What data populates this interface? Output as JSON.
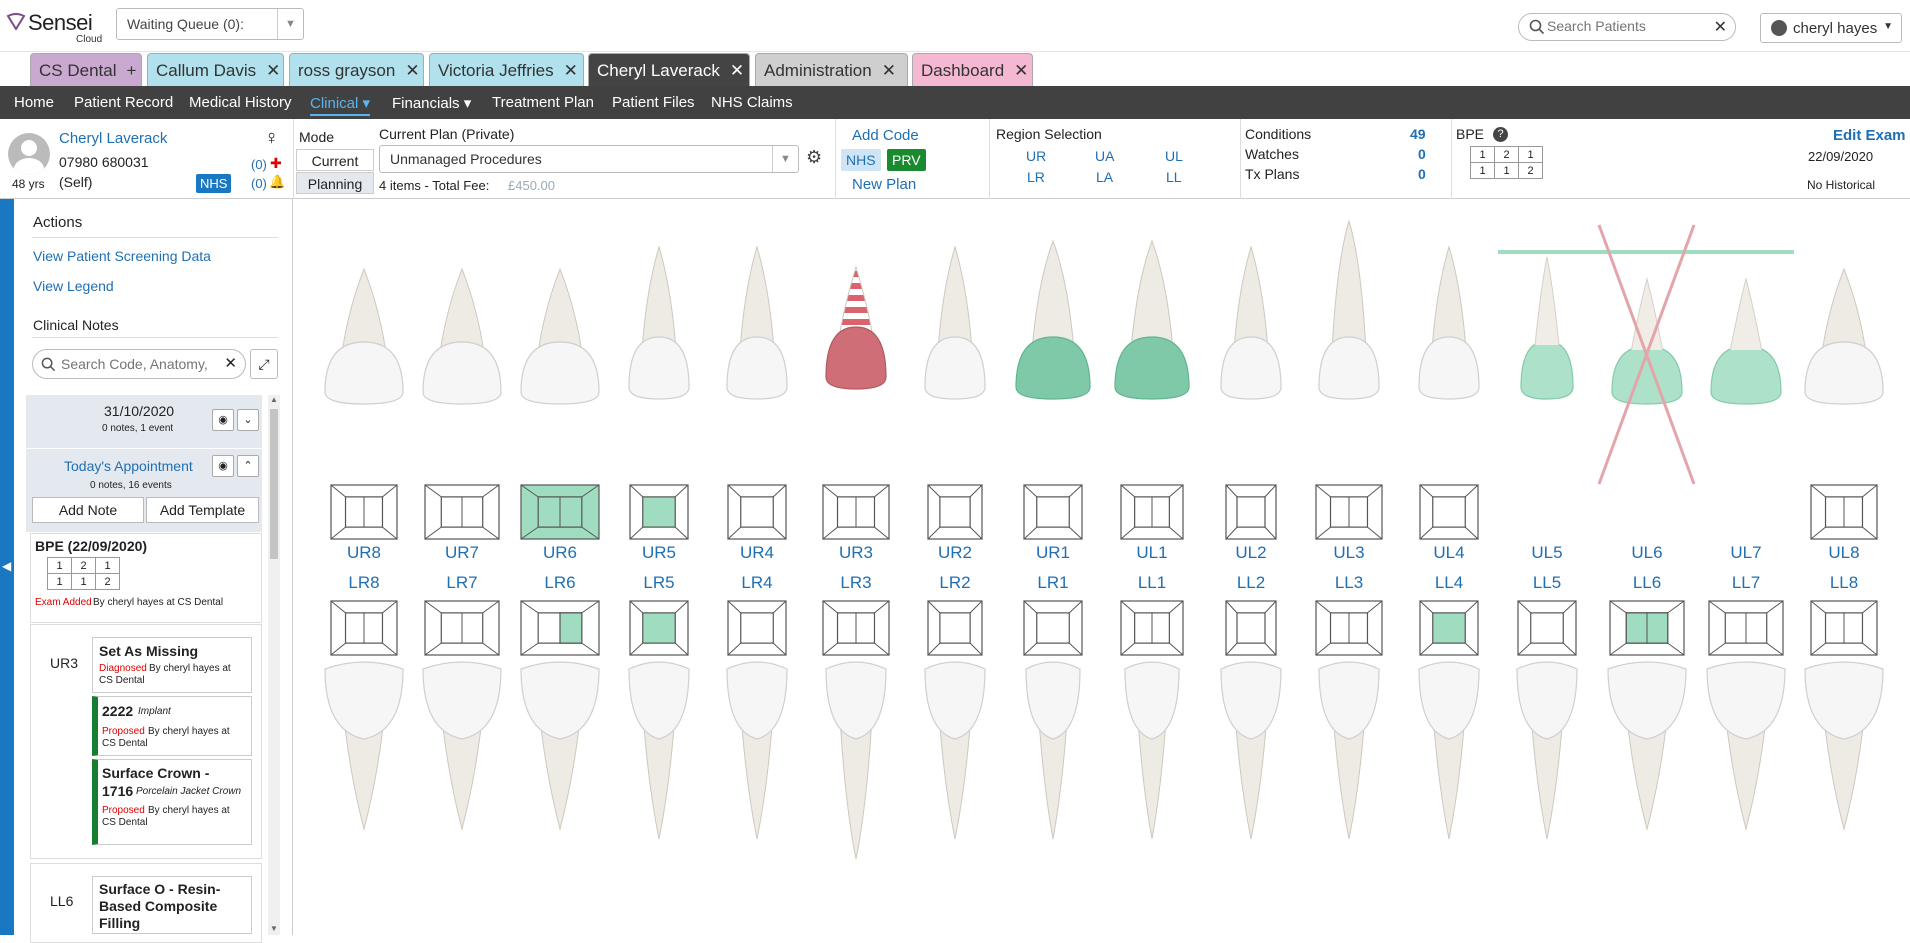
{
  "app": {
    "name": "Sensei",
    "sub": "Cloud"
  },
  "waiting_queue": "Waiting Queue (0):",
  "search": {
    "placeholder": "Search Patients"
  },
  "user": "cheryl hayes",
  "tabs": [
    {
      "label": "CS Dental",
      "icon": "+",
      "bg": "#c9a9cf"
    },
    {
      "label": "Callum Davis",
      "icon": "✕",
      "bg": "#b2e1ee"
    },
    {
      "label": "ross grayson",
      "icon": "✕",
      "bg": "#b2e1ee"
    },
    {
      "label": "Victoria Jeffries",
      "icon": "✕",
      "bg": "#b2e1ee"
    },
    {
      "label": "Cheryl Laverack",
      "icon": "✕",
      "bg": "#444444"
    },
    {
      "label": "Administration",
      "icon": "✕",
      "bg": "#cfcfcf"
    },
    {
      "label": "Dashboard",
      "icon": "✕",
      "bg": "#f4b8d3"
    }
  ],
  "nav": [
    "Home",
    "Patient Record",
    "Medical History",
    "Clinical ▾",
    "Financials ▾",
    "Treatment Plan",
    "Patient Files",
    "NHS Claims"
  ],
  "patient": {
    "name": "Cheryl Laverack",
    "phone": "07980 680031",
    "age": "48 yrs",
    "relation": "(Self)",
    "nhs": "NHS",
    "alerts": "(0)",
    "reminders": "(0)"
  },
  "mode": {
    "label": "Mode",
    "current": "Current",
    "planning": "Planning"
  },
  "plan": {
    "label": "Current Plan (Private)",
    "selected": "Unmanaged Procedures",
    "items": "4 items - Total Fee:",
    "fee": "£450.00"
  },
  "codes": {
    "add": "Add Code",
    "nhs": "NHS",
    "prv": "PRV",
    "new_plan": "New Plan"
  },
  "region": {
    "title": "Region Selection",
    "top": [
      "UR",
      "UA",
      "UL"
    ],
    "bottom": [
      "LR",
      "LA",
      "LL"
    ]
  },
  "stats": [
    {
      "label": "Conditions",
      "value": "49"
    },
    {
      "label": "Watches",
      "value": "0"
    },
    {
      "label": "Tx Plans",
      "value": "0"
    }
  ],
  "bpe": {
    "title": "BPE",
    "scores": [
      [
        "1",
        "2",
        "1"
      ],
      [
        "1",
        "1",
        "2"
      ]
    ]
  },
  "exam": {
    "edit": "Edit Exam",
    "date": "22/09/2020",
    "historical": "No Historical"
  },
  "sidebar": {
    "actions_title": "Actions",
    "actions": [
      "View Patient Screening Data",
      "View Legend"
    ],
    "notes_title": "Clinical Notes",
    "notes_placeholder": "Search Code, Anatomy, Note...",
    "event1": {
      "date": "31/10/2020",
      "meta": "0 notes,  1 event"
    },
    "event2": {
      "title": "Today's Appointment",
      "meta": "0 notes,  16 events"
    },
    "add_note": "Add Note",
    "add_template": "Add Template",
    "bpe_title": "BPE (22/09/2020)",
    "exam_added": "Exam Added",
    "exam_by": "By cheryl hayes at CS Dental",
    "ur3": "UR3",
    "c1": {
      "title": "Set As Missing",
      "status": "Diagnosed",
      "by": "By cheryl hayes at CS Dental"
    },
    "c2": {
      "code": "2222",
      "desc": "Implant",
      "status": "Proposed",
      "by": "By cheryl hayes at CS Dental"
    },
    "c3": {
      "title": "Surface Crown -",
      "code": "1716",
      "desc": "Porcelain Jacket Crown",
      "status": "Proposed",
      "by": "By cheryl hayes at CS Dental"
    },
    "ll6": "LL6",
    "c4": {
      "title": "Surface O - Resin-Based Composite Filling"
    }
  },
  "upper_teeth": [
    "UR8",
    "UR7",
    "UR6",
    "UR5",
    "UR4",
    "UR3",
    "UR2",
    "UR1",
    "UL1",
    "UL2",
    "UL3",
    "UL4",
    "UL5",
    "UL6",
    "UL7",
    "UL8"
  ],
  "lower_teeth": [
    "LR8",
    "LR7",
    "LR6",
    "LR5",
    "LR4",
    "LR3",
    "LR2",
    "LR1",
    "LL1",
    "LL2",
    "LL3",
    "LL4",
    "LL5",
    "LL6",
    "LL7",
    "LL8"
  ],
  "colors": {
    "accent": "#1f6fb4",
    "treated": "#9fdcc0",
    "implant": "#cf6e77",
    "planned": "#7fc9a8"
  }
}
